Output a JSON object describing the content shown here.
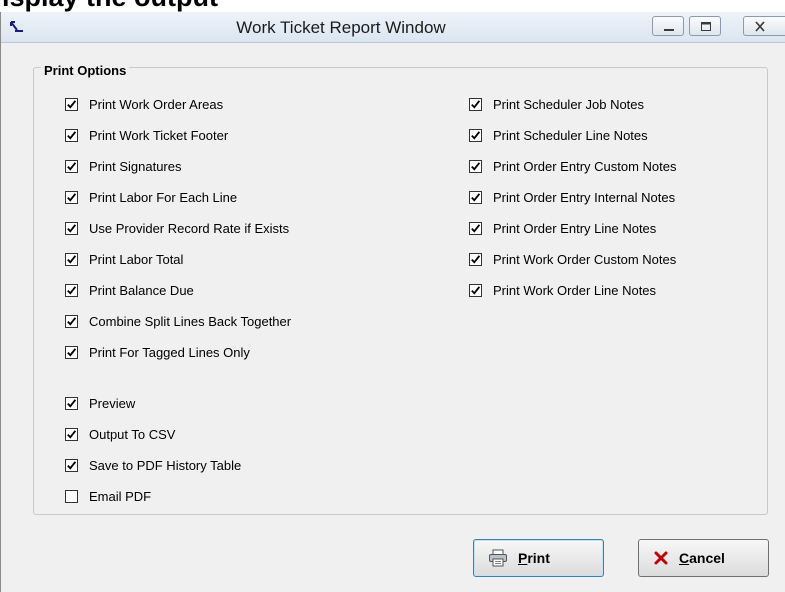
{
  "top_strip_text": "isplay the output",
  "window": {
    "title": "Work Ticket Report Window"
  },
  "group": {
    "label": "Print Options"
  },
  "left_options": [
    {
      "label": "Print Work Order Areas",
      "checked": true
    },
    {
      "label": "Print Work Ticket Footer",
      "checked": true
    },
    {
      "label": "Print Signatures",
      "checked": true
    },
    {
      "label": "Print Labor For Each Line",
      "checked": true
    },
    {
      "label": "Use Provider Record Rate if Exists",
      "checked": true
    },
    {
      "label": "Print Labor Total",
      "checked": true
    },
    {
      "label": "Print Balance Due",
      "checked": true
    },
    {
      "label": "Combine Split Lines Back Together",
      "checked": true
    },
    {
      "label": "Print For Tagged Lines Only",
      "checked": true
    }
  ],
  "right_options": [
    {
      "label": "Print Scheduler Job Notes",
      "checked": true
    },
    {
      "label": "Print Scheduler Line Notes",
      "checked": true
    },
    {
      "label": "Print Order Entry Custom Notes",
      "checked": true
    },
    {
      "label": "Print Order Entry Internal Notes",
      "checked": true
    },
    {
      "label": "Print Order Entry Line Notes",
      "checked": true
    },
    {
      "label": "Print Work Order Custom Notes",
      "checked": true
    },
    {
      "label": "Print Work Order Line Notes",
      "checked": true
    }
  ],
  "output_options": [
    {
      "label": "Preview",
      "checked": true
    },
    {
      "label": "Output To CSV",
      "checked": true
    },
    {
      "label": "Save to PDF History Table",
      "checked": true
    },
    {
      "label": "Email PDF",
      "checked": false
    }
  ],
  "buttons": {
    "print": {
      "mnemonic": "P",
      "rest": "rint",
      "icon": "printer-icon"
    },
    "cancel": {
      "mnemonic": "C",
      "rest": "ancel",
      "icon": "red-x-icon",
      "icon_color": "#c00000"
    }
  }
}
